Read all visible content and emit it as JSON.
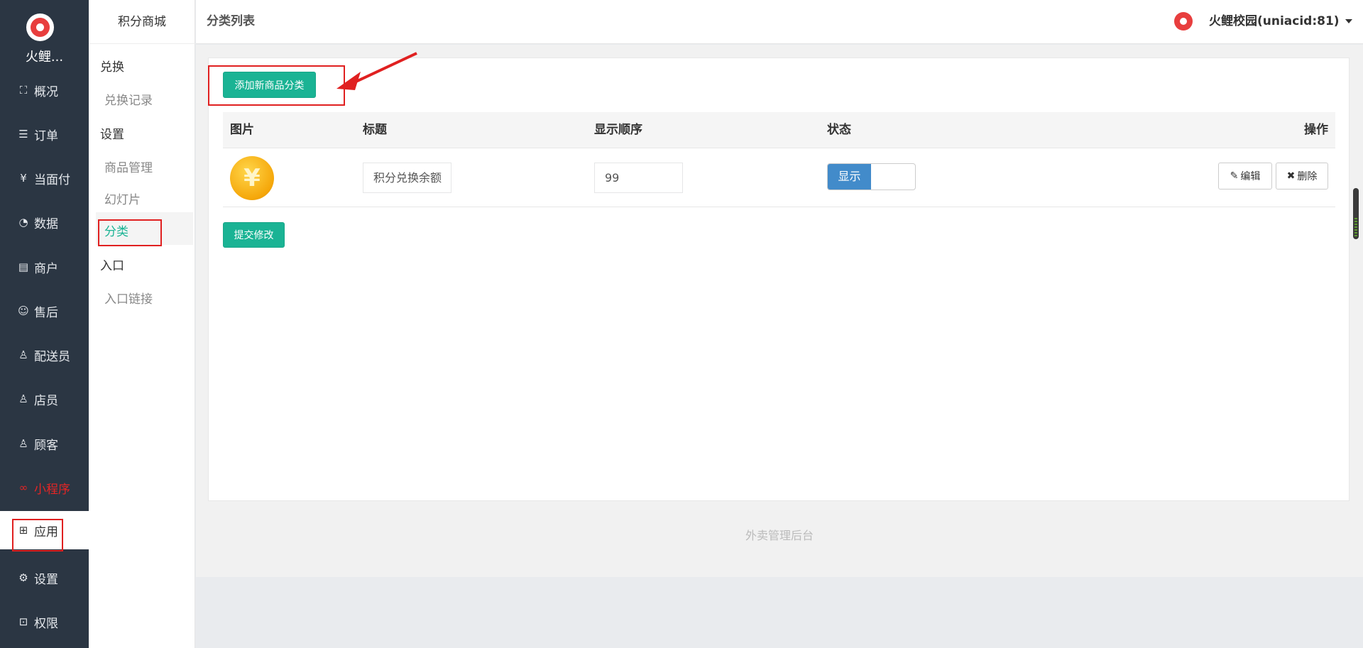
{
  "sidebar": {
    "brand": "火鲤...",
    "items": [
      {
        "label": "概况",
        "icon": "overview-icon"
      },
      {
        "label": "订单",
        "icon": "order-icon"
      },
      {
        "label": "当面付",
        "icon": "yen-icon"
      },
      {
        "label": "数据",
        "icon": "chart-icon"
      },
      {
        "label": "商户",
        "icon": "store-icon"
      },
      {
        "label": "售后",
        "icon": "service-icon"
      },
      {
        "label": "配送员",
        "icon": "courier-icon"
      },
      {
        "label": "店员",
        "icon": "clerk-icon"
      },
      {
        "label": "顾客",
        "icon": "customer-icon"
      },
      {
        "label": "小程序",
        "icon": "miniprogram-icon"
      },
      {
        "label": "应用",
        "icon": "apps-icon"
      },
      {
        "label": "设置",
        "icon": "gear-icon"
      },
      {
        "label": "权限",
        "icon": "lock-icon"
      }
    ]
  },
  "subnav": {
    "title": "积分商城",
    "group_exchange": "兑换",
    "exchange_records": "兑换记录",
    "group_settings": "设置",
    "product_management": "商品管理",
    "slideshow": "幻灯片",
    "category": "分类",
    "group_entry": "入口",
    "entry_link": "入口链接"
  },
  "header": {
    "title": "分类列表",
    "user": "火鲤校园(uniacid:81)"
  },
  "main": {
    "add_button": "添加新商品分类",
    "columns": [
      "图片",
      "标题",
      "显示顺序",
      "状态",
      "操作"
    ],
    "rows": [
      {
        "image": "¥",
        "title": "积分兑换余额",
        "order": "99",
        "status": "显示",
        "edit": "编辑",
        "delete": "删除"
      }
    ],
    "submit_button": "提交修改"
  },
  "footer": "外卖管理后台",
  "colors": {
    "accent": "#1ab394",
    "sidebar": "#2b3643",
    "highlight": "#e52525",
    "toggle": "#428bca"
  }
}
